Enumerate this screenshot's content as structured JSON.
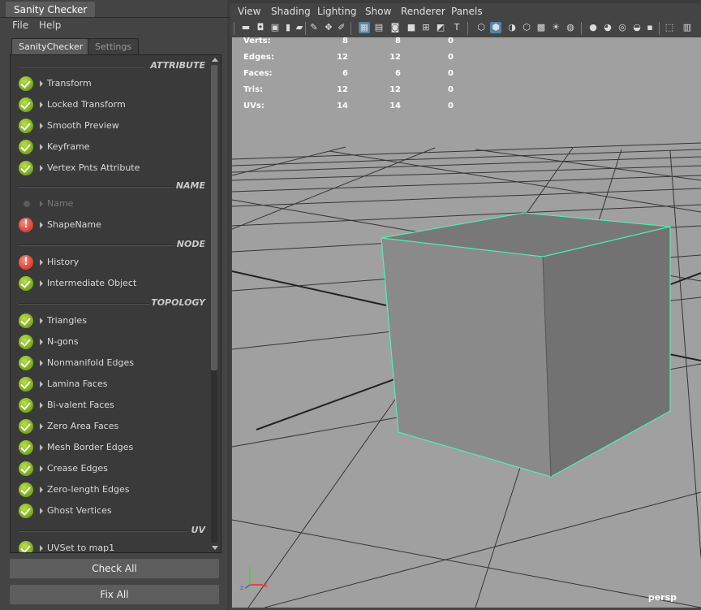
{
  "left_window": {
    "title": "Sanity Checker",
    "menu": [
      "File",
      "Help"
    ],
    "tabs": [
      "SanityChecker",
      "Settings"
    ],
    "sections": [
      {
        "title": "ATTRIBUTE",
        "items": [
          {
            "label": "Transform",
            "status": "ok"
          },
          {
            "label": "Locked Transform",
            "status": "ok"
          },
          {
            "label": "Smooth Preview",
            "status": "ok"
          },
          {
            "label": "Keyframe",
            "status": "ok"
          },
          {
            "label": "Vertex Pnts Attribute",
            "status": "ok"
          }
        ]
      },
      {
        "title": "NAME",
        "items": [
          {
            "label": "Name",
            "status": "disabled"
          },
          {
            "label": "ShapeName",
            "status": "error"
          }
        ]
      },
      {
        "title": "NODE",
        "items": [
          {
            "label": "History",
            "status": "error"
          },
          {
            "label": "Intermediate Object",
            "status": "ok"
          }
        ]
      },
      {
        "title": "TOPOLOGY",
        "items": [
          {
            "label": "Triangles",
            "status": "ok"
          },
          {
            "label": "N-gons",
            "status": "ok"
          },
          {
            "label": "Nonmanifold Edges",
            "status": "ok"
          },
          {
            "label": "Lamina Faces",
            "status": "ok"
          },
          {
            "label": "Bi-valent Faces",
            "status": "ok"
          },
          {
            "label": "Zero Area Faces",
            "status": "ok"
          },
          {
            "label": "Mesh Border Edges",
            "status": "ok"
          },
          {
            "label": "Crease Edges",
            "status": "ok"
          },
          {
            "label": "Zero-length Edges",
            "status": "ok"
          },
          {
            "label": "Ghost Vertices",
            "status": "ok"
          }
        ]
      },
      {
        "title": "UV",
        "items": [
          {
            "label": "UVSet to map1",
            "status": "ok"
          }
        ]
      }
    ],
    "buttons": {
      "check_all": "Check All",
      "fix_all": "Fix All"
    },
    "scroll_position": 0
  },
  "viewport": {
    "menu": [
      "View",
      "Shading",
      "Lighting",
      "Show",
      "Renderer",
      "Panels"
    ],
    "hud": [
      {
        "label": "Verts:",
        "v1": "8",
        "v2": "8",
        "v3": "0"
      },
      {
        "label": "Edges:",
        "v1": "12",
        "v2": "12",
        "v3": "0"
      },
      {
        "label": "Faces:",
        "v1": "6",
        "v2": "6",
        "v3": "0"
      },
      {
        "label": "Tris:",
        "v1": "12",
        "v2": "12",
        "v3": "0"
      },
      {
        "label": "UVs:",
        "v1": "14",
        "v2": "14",
        "v3": "0"
      }
    ],
    "camera": "persp",
    "axis_labels": {
      "x": "x",
      "y": "y",
      "z": "z"
    },
    "colors": {
      "background": "#a0a0a0",
      "selection": "#4ef0b0",
      "axis_x": "#e03030",
      "axis_y": "#40d040",
      "axis_z": "#3060e0"
    }
  }
}
